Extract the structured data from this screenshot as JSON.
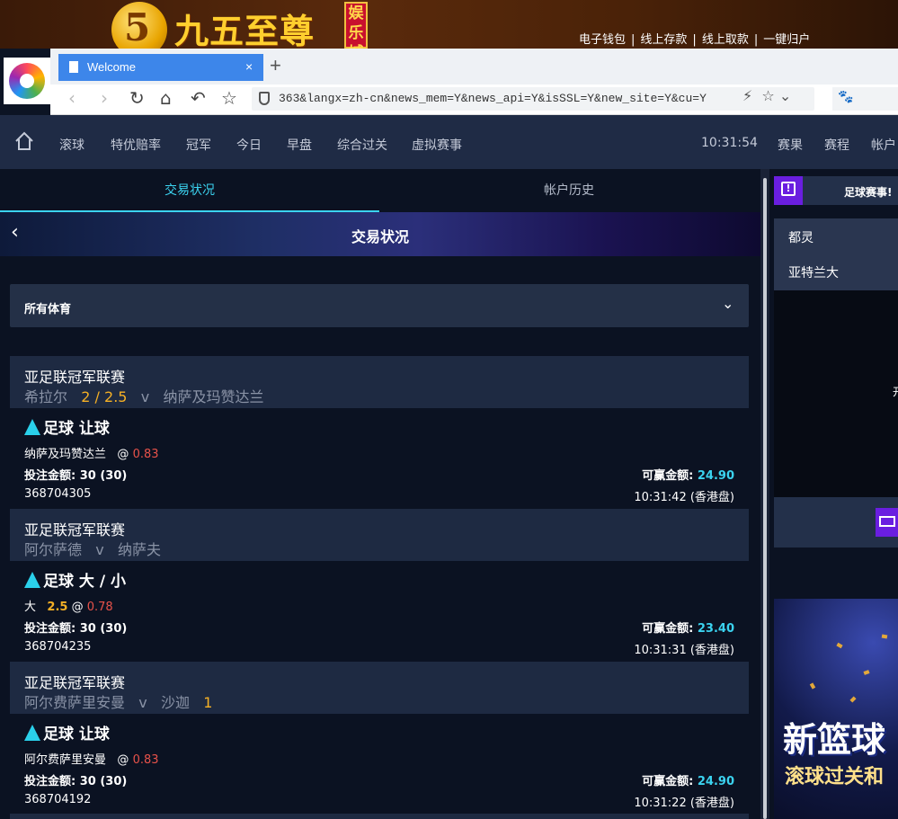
{
  "banner": {
    "logo_glyph": "5",
    "logo_text": "九五至尊",
    "logo_tag": "娱乐城",
    "links": [
      "电子钱包",
      "线上存款",
      "线上取款",
      "一键归户"
    ]
  },
  "browser": {
    "tab_title": "Welcome",
    "tab_close": "×",
    "new_tab": "+",
    "url": "363&langx=zh-cn&news_mem=Y&news_api=Y&isSSL=Y&new_site=Y&cu=Y"
  },
  "sitenav": {
    "items": [
      "滚球",
      "特优赔率",
      "冠军",
      "今日",
      "早盘",
      "综合过关",
      "虚拟赛事"
    ],
    "clock": "10:31:54",
    "right_items": [
      "赛果",
      "赛程",
      "帐户"
    ]
  },
  "subtabs": [
    "交易状况",
    "帐户历史"
  ],
  "hero_title": "交易状况",
  "filter_label": "所有体育",
  "bets": [
    {
      "league": "亚足联冠军联赛",
      "home": "希拉尔",
      "line": "2 / 2.5",
      "vs": "v",
      "away": "纳萨及玛赞达兰",
      "market": "足球 让球",
      "selection": "纳萨及玛赞达兰",
      "sel_line": "",
      "at": "@",
      "odds": "0.83",
      "stake_label": "投注金额:",
      "stake": "30 (30)",
      "win_label": "可赢金额:",
      "win": "24.90",
      "ticket": "368704305",
      "time": "10:31:42 (香港盘)"
    },
    {
      "league": "亚足联冠军联赛",
      "home": "阿尔萨德",
      "line": "",
      "vs": "v",
      "away": "纳萨夫",
      "market": "足球 大 / 小",
      "selection": "大",
      "sel_line": "2.5",
      "at": "@",
      "odds": "0.78",
      "stake_label": "投注金额:",
      "stake": "30 (30)",
      "win_label": "可赢金额:",
      "win": "23.40",
      "ticket": "368704235",
      "time": "10:31:31 (香港盘)"
    },
    {
      "league": "亚足联冠军联赛",
      "home": "阿尔费萨里安曼",
      "line": "",
      "vs": "v",
      "away": "沙迦",
      "away_line": "1",
      "market": "足球 让球",
      "selection": "阿尔费萨里安曼",
      "sel_line": "",
      "at": "@",
      "odds": "0.83",
      "stake_label": "投注金额:",
      "stake": "30 (30)",
      "win_label": "可赢金额:",
      "win": "24.90",
      "ticket": "368704192",
      "time": "10:31:22 (香港盘)"
    }
  ],
  "right": {
    "header": "足球赛事!",
    "list": [
      "都灵",
      "亚特兰大"
    ],
    "dark_stub": "开",
    "promo_big": "新篮球",
    "promo_small": "滚球过关和"
  },
  "colors": {
    "accent": "#3bd3f0",
    "odds": "#e8524a",
    "line": "#f5b025",
    "purple": "#6a1ee0"
  }
}
